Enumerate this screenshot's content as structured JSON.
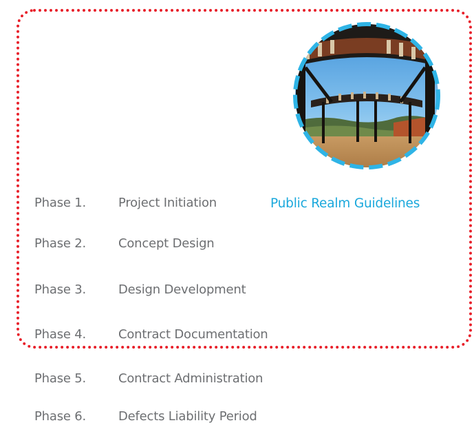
{
  "highlight_label": "Public Realm Guidelines",
  "phases": [
    {
      "number": "Phase 1.",
      "title": "Project Initiation"
    },
    {
      "number": "Phase 2.",
      "title": "Concept Design"
    },
    {
      "number": "Phase 3.",
      "title": "Design Development"
    },
    {
      "number": "Phase 4.",
      "title": "Contract Documentation"
    },
    {
      "number": "Phase 5.",
      "title": "Contract Administration"
    },
    {
      "number": "Phase 6.",
      "title": "Defects Liability Period"
    }
  ],
  "colors": {
    "frame_border": "#e8202a",
    "highlight_text": "#1aa8dc",
    "photo_ring": "#2fb4e6",
    "phase_text": "#6d6f72"
  }
}
